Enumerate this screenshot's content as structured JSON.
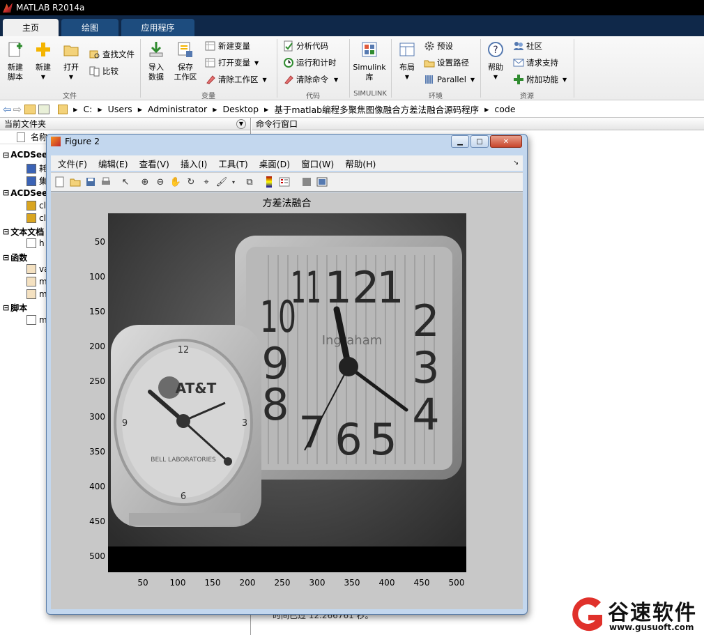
{
  "app_title": "MATLAB R2014a",
  "tabs": [
    {
      "label": "主页"
    },
    {
      "label": "绘图"
    },
    {
      "label": "应用程序"
    }
  ],
  "ribbon": {
    "new_script": "新建\n脚本",
    "new": "新建",
    "open": "打开",
    "find_files": "查找文件",
    "compare": "比较",
    "import_data": "导入\n数据",
    "save_workspace": "保存\n工作区",
    "new_variable": "新建变量",
    "open_variable": "打开变量",
    "clear_workspace": "清除工作区",
    "analyze_code": "分析代码",
    "run_and_time": "运行和计时",
    "clear_commands": "清除命令",
    "simulink_library": "Simulink\n库",
    "layout": "布局",
    "preferences": "预设",
    "set_path": "设置路径",
    "parallel": "Parallel",
    "help": "帮助",
    "community": "社区",
    "request_support": "请求支持",
    "add_ons": "附加功能",
    "groups": {
      "file": "文件",
      "variable": "变量",
      "code": "代码",
      "simulink": "SIMULINK",
      "environment": "环境",
      "resources": "资源"
    }
  },
  "address": {
    "segments": [
      "C:",
      "Users",
      "Administrator",
      "Desktop",
      "基于matlab编程多聚焦图像融合方差法融合源码程序",
      "code"
    ]
  },
  "left_panel": {
    "title": "当前文件夹",
    "col_name": "名称",
    "tree": [
      {
        "label": "ACDSee",
        "bold": true,
        "indent": 0
      },
      {
        "label": "耗",
        "bold": false,
        "indent": 1,
        "icon": "bmp"
      },
      {
        "label": "集",
        "bold": false,
        "indent": 1,
        "icon": "bmp"
      },
      {
        "label": "ACDSee",
        "bold": true,
        "indent": 0
      },
      {
        "label": "cl",
        "bold": false,
        "indent": 1,
        "icon": "jpg"
      },
      {
        "label": "cl",
        "bold": false,
        "indent": 1,
        "icon": "jpg"
      },
      {
        "label": "文本文档",
        "bold": true,
        "indent": 0
      },
      {
        "label": "h",
        "bold": false,
        "indent": 1,
        "icon": "txt"
      },
      {
        "label": "函数",
        "bold": true,
        "indent": 0
      },
      {
        "label": "va",
        "bold": false,
        "indent": 1,
        "icon": "fx"
      },
      {
        "label": "m",
        "bold": false,
        "indent": 1,
        "icon": "fx"
      },
      {
        "label": "m",
        "bold": false,
        "indent": 1,
        "icon": "fx"
      },
      {
        "label": "脚本",
        "bold": true,
        "indent": 0
      },
      {
        "label": "m",
        "bold": false,
        "indent": 1,
        "icon": "script"
      }
    ]
  },
  "right_panel": {
    "title": "命令行窗口",
    "bottom_text": "时间已过 12.266761 秒。"
  },
  "figure": {
    "title": "Figure 2",
    "menu": [
      "文件(F)",
      "编辑(E)",
      "查看(V)",
      "插入(I)",
      "工具(T)",
      "桌面(D)",
      "窗口(W)",
      "帮助(H)"
    ],
    "axes_title": "方差法融合",
    "yticks": [
      "50",
      "100",
      "150",
      "200",
      "250",
      "300",
      "350",
      "400",
      "450",
      "500"
    ],
    "xticks": [
      "50",
      "100",
      "150",
      "200",
      "250",
      "300",
      "350",
      "400",
      "450",
      "500"
    ],
    "clock_left": {
      "numbers": [
        "12",
        "3",
        "6",
        "9"
      ],
      "brand": "AT&T",
      "sub": "BELL LABORATORIES"
    },
    "clock_right": {
      "numbers": [
        "12",
        "1",
        "2",
        "3",
        "4",
        "5",
        "6",
        "7",
        "8",
        "9",
        "10",
        "11"
      ],
      "brand": "Ingraham"
    }
  },
  "watermark": {
    "name": "谷速软件",
    "url": "www.gusuoft.com",
    "color": "#e0312b"
  }
}
